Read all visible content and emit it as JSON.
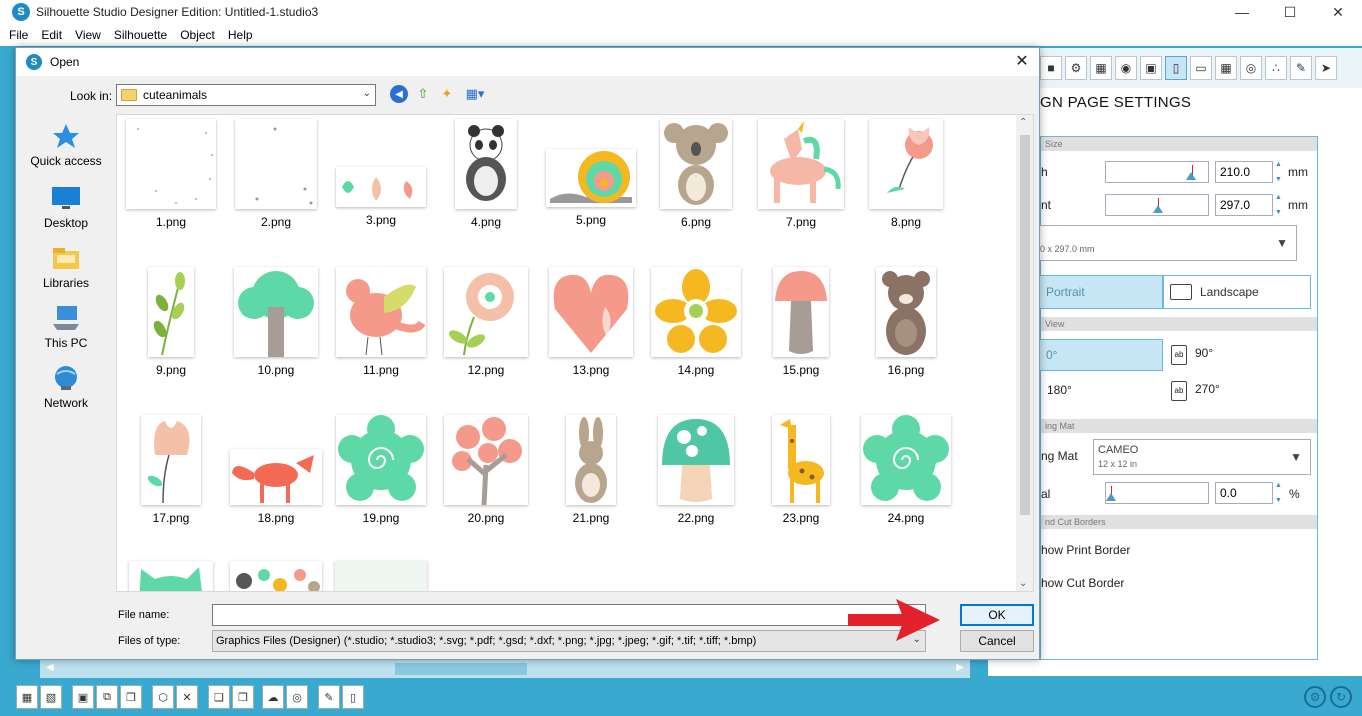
{
  "app": {
    "title": "Silhouette Studio Designer Edition: Untitled-1.studio3",
    "menu": [
      "File",
      "Edit",
      "View",
      "Silhouette",
      "Object",
      "Help"
    ]
  },
  "right_panel": {
    "title": "GN PAGE SETTINGS",
    "sections": {
      "size": "Size",
      "view": "View",
      "mat": "ing Mat",
      "borders": "nd Cut Borders"
    },
    "width_label": "h",
    "width_value": "210.0",
    "height_label": "nt",
    "height_value": "297.0",
    "unit": "mm",
    "size_preset": "0 x 297.0 mm",
    "orientation": {
      "portrait": "Portrait",
      "landscape": "Landscape"
    },
    "rotation": {
      "r0": "0°",
      "r90": "90°",
      "r180": "180°",
      "r270": "270°",
      "ab": "ab"
    },
    "mat_label": "ng Mat",
    "mat_name": "CAMEO",
    "mat_size": "12 x 12 in",
    "reveal_label": "al",
    "reveal_value": "0.0",
    "percent": "%",
    "show_print_border": "how Print Border",
    "show_cut_border": "how Cut Border"
  },
  "dialog": {
    "title": "Open",
    "look_in_label": "Look in:",
    "look_in_value": "cuteanimals",
    "places": [
      "Quick access",
      "Desktop",
      "Libraries",
      "This PC",
      "Network"
    ],
    "files": [
      "1.png",
      "2.png",
      "3.png",
      "4.png",
      "5.png",
      "6.png",
      "7.png",
      "8.png",
      "9.png",
      "10.png",
      "11.png",
      "12.png",
      "13.png",
      "14.png",
      "15.png",
      "16.png",
      "17.png",
      "18.png",
      "19.png",
      "20.png",
      "21.png",
      "22.png",
      "23.png",
      "24.png"
    ],
    "file_name_label": "File name:",
    "file_name_value": "",
    "files_of_type_label": "Files of type:",
    "files_of_type_value": "Graphics Files (Designer) (*.studio; *.studio3; *.svg; *.pdf; *.gsd; *.dxf; *.png; *.jpg; *.jpeg; *.gif; *.tif; *.tiff; *.bmp)",
    "ok_label": "OK",
    "cancel_label": "Cancel"
  },
  "colors": {
    "accent": "#3aa9cf",
    "arrow": "#e3232b",
    "mint": "#5fd8a8",
    "coral": "#f59a8a",
    "yellow": "#f5b820"
  }
}
